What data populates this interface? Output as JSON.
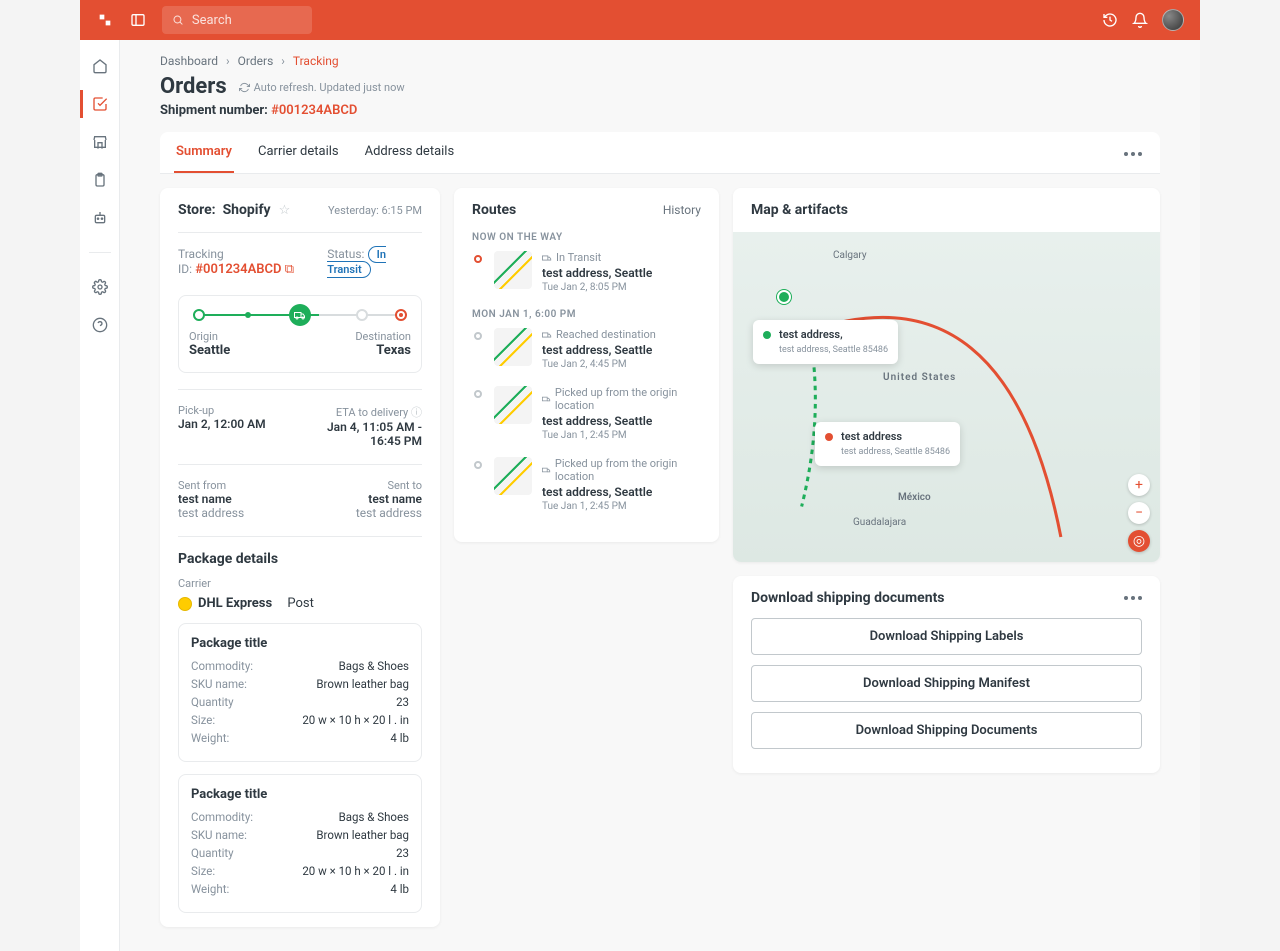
{
  "search_placeholder": "Search",
  "breadcrumb": [
    "Dashboard",
    "Orders",
    "Tracking"
  ],
  "page_title": "Orders",
  "refresh_note": "Auto refresh. Updated just now",
  "shipment_label": "Shipment number:",
  "shipment_number": "#001234ABCD",
  "tabs": [
    "Summary",
    "Carrier details",
    "Address details"
  ],
  "store": {
    "label": "Store:",
    "name": "Shopify",
    "timestamp": "Yesterday: 6:15 PM",
    "tracking_label": "Tracking ID:",
    "tracking_id": "#001234ABCD",
    "status_label": "Status:",
    "status_badge": "In Transit",
    "origin_label": "Origin",
    "origin": "Seattle",
    "dest_label": "Destination",
    "dest": "Texas",
    "pickup_label": "Pick-up",
    "pickup": "Jan 2, 12:00 AM",
    "eta_label": "ETA to delivery",
    "eta": "Jan 4, 11:05 AM - 16:45 PM",
    "sent_from_label": "Sent from",
    "sent_from_name": "test name",
    "sent_from_addr": "test address",
    "sent_to_label": "Sent to",
    "sent_to_name": "test name",
    "sent_to_addr": "test address"
  },
  "package": {
    "section_title": "Package details",
    "carrier_label": "Carrier",
    "carrier": "DHL Express",
    "carrier_type": "Post",
    "items": [
      {
        "title": "Package title",
        "commodity_label": "Commodity:",
        "commodity": "Bags & Shoes",
        "sku_label": "SKU name:",
        "sku": "Brown leather bag",
        "qty_label": "Quantity",
        "qty": "23",
        "size_label": "Size:",
        "size": "20 w × 10 h × 20 l . in",
        "weight_label": "Weight:",
        "weight": "4 lb"
      },
      {
        "title": "Package title",
        "commodity_label": "Commodity:",
        "commodity": "Bags & Shoes",
        "sku_label": "SKU name:",
        "sku": "Brown leather bag",
        "qty_label": "Quantity",
        "qty": "23",
        "size_label": "Size:",
        "size": "20 w × 10 h × 20 l . in",
        "weight_label": "Weight:",
        "weight": "4 lb"
      }
    ]
  },
  "routes": {
    "title": "Routes",
    "history_link": "History",
    "sections": [
      {
        "label": "NOW ON THE WAY",
        "items": [
          {
            "status": "In Transit",
            "addr": "test address, Seattle",
            "time": "Tue Jan 2, 8:05 PM"
          }
        ]
      },
      {
        "label": "MON JAN 1, 6:00 PM",
        "items": [
          {
            "status": "Reached destination",
            "addr": "test address, Seattle",
            "time": "Tue Jan 2, 4:45 PM"
          },
          {
            "status": "Picked up from the origin location",
            "addr": "test address, Seattle",
            "time": "Tue Jan 1, 2:45 PM"
          },
          {
            "status": "Picked up from the origin location",
            "addr": "test address, Seattle",
            "time": "Tue Jan 1, 2:45 PM"
          }
        ]
      }
    ]
  },
  "map": {
    "title": "Map & artifacts",
    "pop1_title": "test address,",
    "pop1_sub": "test address, Seattle 85486",
    "pop2_title": "test address",
    "pop2_sub": "test address, Seattle 85486",
    "country": "United States",
    "mexico": "México",
    "calgary": "Calgary",
    "guadalajara": "Guadalajara"
  },
  "downloads": {
    "title": "Download shipping documents",
    "buttons": [
      "Download Shipping Labels",
      "Download Shipping Manifest",
      "Download Shipping Documents"
    ]
  }
}
